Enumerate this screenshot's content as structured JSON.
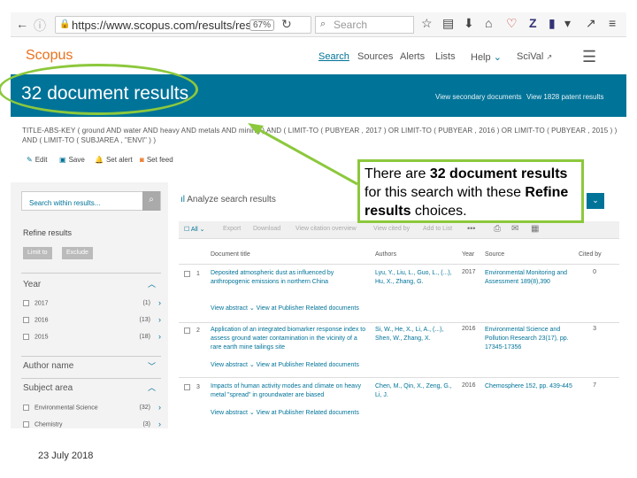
{
  "browser": {
    "url": "https://www.scopus.com/results/result",
    "zoom": "67%",
    "search_placeholder": "Search"
  },
  "nav": {
    "logo": "Scopus",
    "links": [
      "Search",
      "Sources",
      "Alerts",
      "Lists",
      "Help",
      "SciVal"
    ]
  },
  "hero": {
    "title": "32 document results",
    "secondary_link": "View secondary documents",
    "patent_link": "View 1828 patent results"
  },
  "query": {
    "line1": "TITLE-ABS-KEY ( ground AND water AND heavy AND metals AND mining ) AND ( LIMIT-TO ( PUBYEAR , 2017 ) OR LIMIT-TO ( PUBYEAR , 2016 ) OR LIMIT-TO ( PUBYEAR , 2015 ) )",
    "line2": "AND ( LIMIT-TO ( SUBJAREA , \"ENVI\" ) )"
  },
  "actions": [
    "Edit",
    "Save",
    "Set alert",
    "Set feed"
  ],
  "left": {
    "search_within": "Search within results...",
    "refine_title": "Refine results",
    "limit_to": "Limit to",
    "exclude": "Exclude",
    "year_heading": "Year",
    "years": [
      {
        "label": "2017",
        "count": "(1)"
      },
      {
        "label": "2016",
        "count": "(13)"
      },
      {
        "label": "2015",
        "count": "(18)"
      }
    ],
    "author_heading": "Author name",
    "subject_heading": "Subject area",
    "subjects": [
      {
        "label": "Environmental Science",
        "count": "(32)"
      },
      {
        "label": "Chemistry",
        "count": "(3)"
      }
    ]
  },
  "main": {
    "analyze": "Analyze search results",
    "tools": [
      "All",
      "Export",
      "Download",
      "View citation overview",
      "View cited by",
      "Add to List"
    ],
    "headers": {
      "title": "Document title",
      "authors": "Authors",
      "year": "Year",
      "source": "Source",
      "cited": "Cited by"
    },
    "results": [
      {
        "num": "1",
        "title": "Deposited atmospheric dust as influenced by anthropogenic emissions in northern China",
        "authors": "Lyu, Y., Liu, L., Guo, L., (...), Hu, X., Zhang, G.",
        "year": "2017",
        "source": "Environmental Monitoring and Assessment 189(8),390",
        "cited": "0",
        "links": "View abstract ⌄   View at Publisher   Related documents"
      },
      {
        "num": "2",
        "title": "Application of an integrated biomarker response index to assess ground water contamination in the vicinity of a rare earth mine tailings site",
        "authors": "Si, W., He, X., Li, A., (...), Shen, W., Zhang, X.",
        "year": "2016",
        "source": "Environmental Science and Pollution Research 23(17), pp. 17345-17356",
        "cited": "3",
        "links": "View abstract ⌄   View at Publisher   Related documents"
      },
      {
        "num": "3",
        "title": "Impacts of human activity modes and climate on heavy metal \"spread\" in groundwater are biased",
        "authors": "Chen, M., Qin, X., Zeng, G., Li, J.",
        "year": "2016",
        "source": "Chemosphere 152, pp. 439-445",
        "cited": "7",
        "links": "View abstract ⌄   View at Publisher   Related documents"
      }
    ]
  },
  "callout": {
    "p1": "There are ",
    "b1": "32 document results",
    "p2": " for this search with these ",
    "b2": "Refine results",
    "p3": " choices."
  },
  "footer_date": "23 July 2018",
  "colors": {
    "brand": "#007398",
    "accent": "#8cc83c",
    "logo": "#e9711c"
  }
}
